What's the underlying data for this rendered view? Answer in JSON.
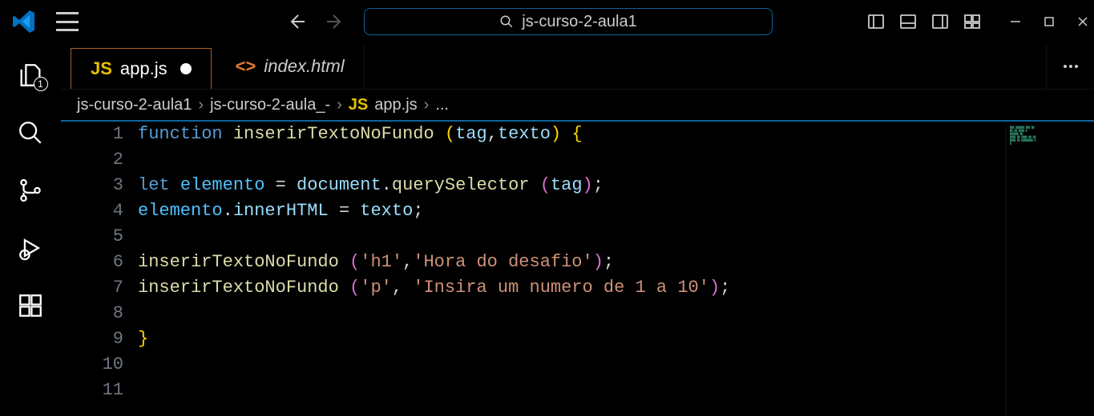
{
  "titlebar": {
    "search_icon": "search",
    "search_text": "js-curso-2-aula1"
  },
  "activitybar": {
    "explorer_badge": "1"
  },
  "tabs": [
    {
      "icon": "JS",
      "icon_color": "#e8c000",
      "label": "app.js",
      "active": true,
      "dirty": true
    },
    {
      "icon": "<>",
      "icon_color": "#e37933",
      "label": "index.html",
      "active": false,
      "dirty": false
    }
  ],
  "breadcrumbs": {
    "parts": [
      {
        "text": "js-curso-2-aula1"
      },
      {
        "text": "js-curso-2-aula_-"
      },
      {
        "js": true,
        "text": "app.js"
      },
      {
        "text": "..."
      }
    ]
  },
  "code": {
    "lines": [
      {
        "n": "1",
        "html": "<span class='tok-kw2'>function</span> <span class='tok-fn'>inserirTextoNoFundo</span> <span class='tok-brace'>(</span><span class='tok-id'>tag</span><span class='tok-op'>,</span><span class='tok-id'>texto</span><span class='tok-brace'>)</span> <span class='tok-brace'>{</span>"
      },
      {
        "n": "2",
        "html": ""
      },
      {
        "n": "3",
        "html": "<span class='tok-kw2'>let</span> <span class='tok-var'>elemento</span> <span class='tok-op'>=</span> <span class='tok-id'>document</span><span class='tok-op'>.</span><span class='tok-fn'>querySelector</span> <span class='tok-paren'>(</span><span class='tok-id'>tag</span><span class='tok-paren'>)</span><span class='tok-op'>;</span>"
      },
      {
        "n": "4",
        "html": "<span class='tok-var'>elemento</span><span class='tok-op'>.</span><span class='tok-id'>innerHTML</span> <span class='tok-op'>=</span> <span class='tok-id'>texto</span><span class='tok-op'>;</span>"
      },
      {
        "n": "5",
        "html": ""
      },
      {
        "n": "6",
        "html": "<span class='tok-fn'>inserirTextoNoFundo</span> <span class='tok-paren'>(</span><span class='tok-str'>'h1'</span><span class='tok-op'>,</span><span class='tok-str'>'Hora do desafio'</span><span class='tok-paren'>)</span><span class='tok-op'>;</span>"
      },
      {
        "n": "7",
        "html": "<span class='tok-fn'>inserirTextoNoFundo</span> <span class='tok-paren'>(</span><span class='tok-str'>'p'</span><span class='tok-op'>,</span> <span class='tok-str'>'Insira um numero de 1 a 10'</span><span class='tok-paren'>)</span><span class='tok-op'>;</span>"
      },
      {
        "n": "8",
        "html": ""
      },
      {
        "n": "9",
        "html": "<span class='tok-brace'>}</span>"
      },
      {
        "n": "10",
        "html": ""
      },
      {
        "n": "11",
        "html": ""
      }
    ]
  }
}
